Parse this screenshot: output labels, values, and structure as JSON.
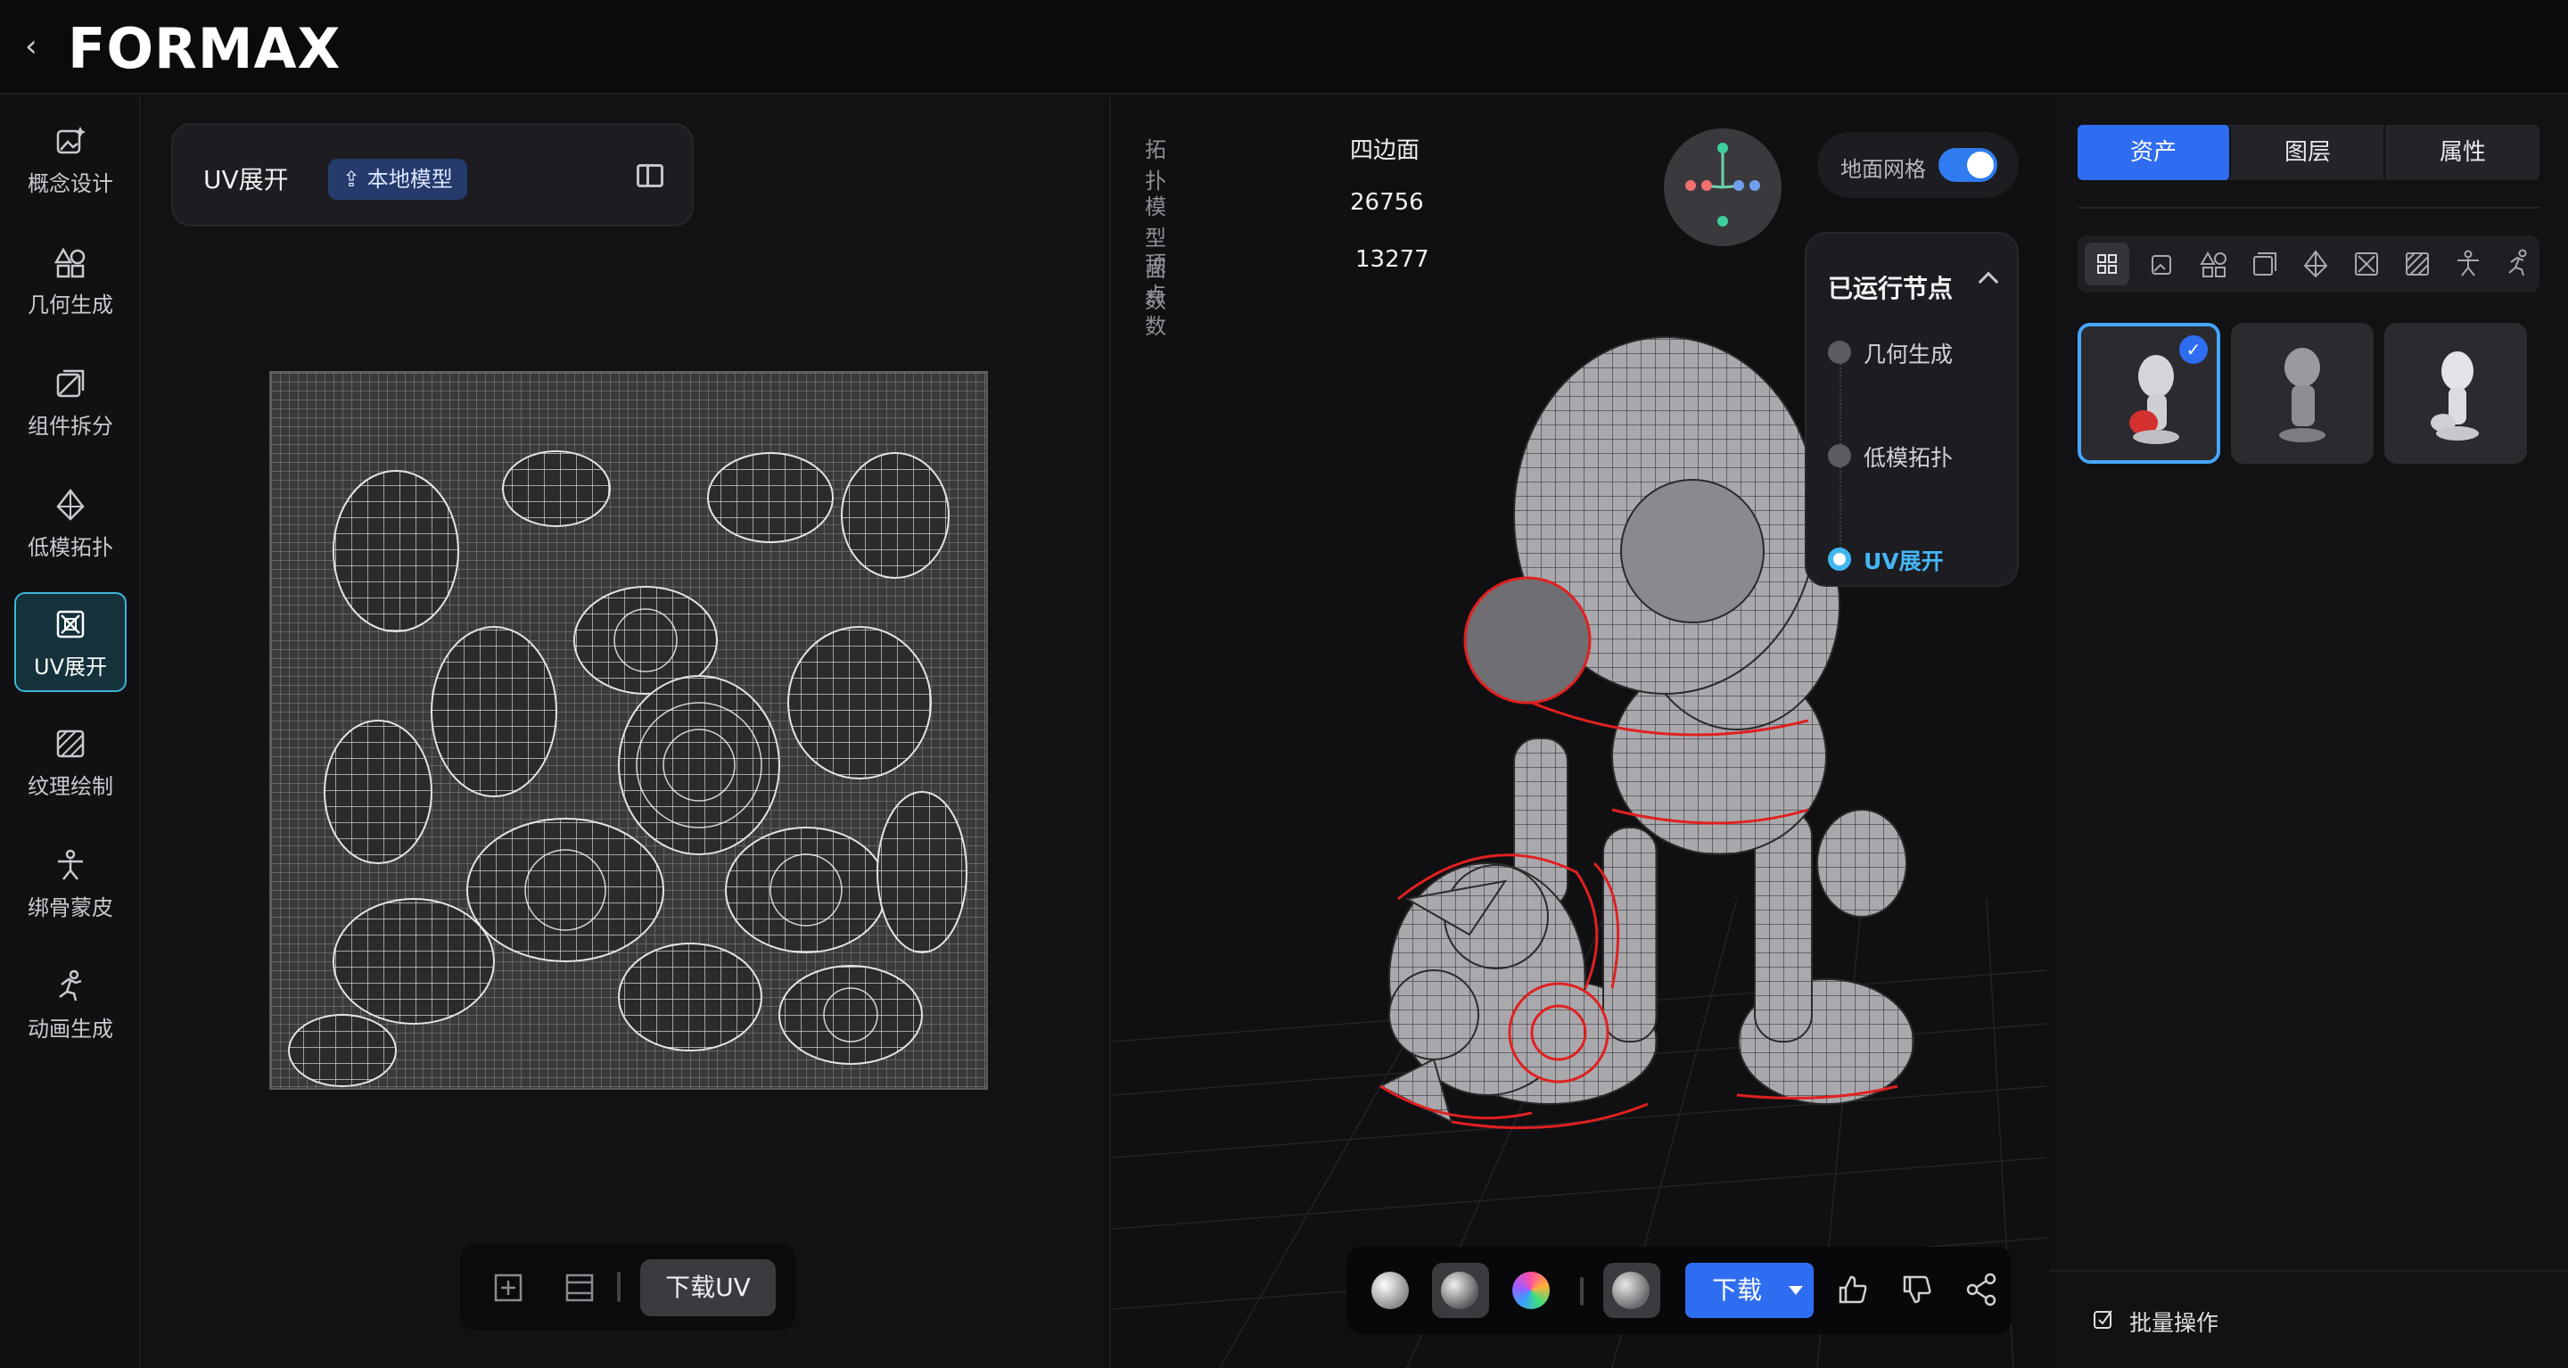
{
  "app": {
    "logo_text": "FORMAX"
  },
  "sidebar": {
    "items": [
      {
        "label": "概念设计",
        "icon": "image-sparkle-icon"
      },
      {
        "label": "几何生成",
        "icon": "shapes-icon"
      },
      {
        "label": "组件拆分",
        "icon": "split-square-icon"
      },
      {
        "label": "低模拓扑",
        "icon": "pyramid-icon"
      },
      {
        "label": "UV展开",
        "icon": "uv-unwrap-icon",
        "active": true
      },
      {
        "label": "纹理绘制",
        "icon": "texture-icon"
      },
      {
        "label": "绑骨蒙皮",
        "icon": "rig-figure-icon"
      },
      {
        "label": "动画生成",
        "icon": "running-figure-icon"
      }
    ]
  },
  "uv_panel": {
    "title": "UV展开",
    "source_badge": "本地模型",
    "download_label": "下载UV"
  },
  "viewport": {
    "stats": [
      {
        "key": "拓扑",
        "value": "四边面"
      },
      {
        "key": "模型面数",
        "value": "26756"
      },
      {
        "key": "顶点数",
        "value": "13277"
      }
    ],
    "ground_grid_label": "地面网格",
    "ground_grid_on": true,
    "nodes_title": "已运行节点",
    "nodes": [
      {
        "label": "几何生成",
        "active": false
      },
      {
        "label": "低模拓扑",
        "active": false
      },
      {
        "label": "UV展开",
        "active": true
      }
    ],
    "download_label": "下载"
  },
  "right_panel": {
    "tabs": [
      {
        "label": "资产",
        "active": true
      },
      {
        "label": "图层",
        "active": false
      },
      {
        "label": "属性",
        "active": false
      }
    ],
    "batch_label": "批量操作"
  },
  "colors": {
    "accent": "#2f6df0",
    "active_cyan": "#3fb6d6",
    "wire_red": "#e02020"
  }
}
